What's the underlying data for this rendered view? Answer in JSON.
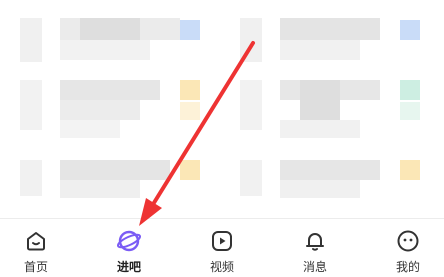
{
  "tabbar": {
    "active_index": 1,
    "tabs": [
      {
        "label": "首页",
        "icon": "home-icon"
      },
      {
        "label": "进吧",
        "icon": "planet-icon"
      },
      {
        "label": "视频",
        "icon": "video-play-icon"
      },
      {
        "label": "消息",
        "icon": "bell-icon"
      },
      {
        "label": "我的",
        "icon": "profile-face-icon"
      }
    ]
  },
  "colors": {
    "accent": "#7b5cf5",
    "icon": "#333333",
    "annotation_arrow": "#ee3333",
    "blur_gray": "#e3e3e3",
    "blur_blue": "#c9dcf8",
    "blur_yellow": "#fbe7b6",
    "blur_green": "#cdeee2"
  },
  "annotation": {
    "type": "arrow",
    "points_to": "tab-jinba"
  }
}
